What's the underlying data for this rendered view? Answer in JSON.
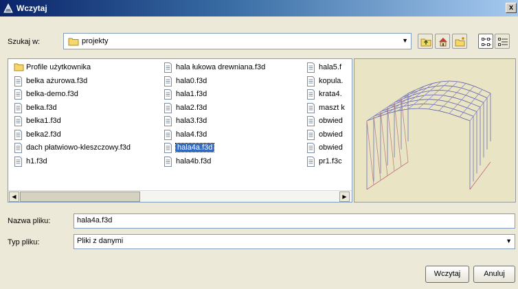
{
  "window": {
    "title": "Wczytaj",
    "close_glyph": "x"
  },
  "lookin": {
    "label": "Szukaj w:",
    "value": "projekty"
  },
  "toolbar": {
    "icons": [
      "up-folder-icon",
      "home-icon",
      "new-folder-icon",
      "list-view-icon",
      "details-view-icon"
    ]
  },
  "files": {
    "columns": [
      [
        "Profile użytkownika",
        "belka ażurowa.f3d",
        "belka-demo.f3d",
        "belka.f3d",
        "belka1.f3d",
        "belka2.f3d",
        "dach płatwiowo-kleszczowy.f3d",
        "h1.f3d"
      ],
      [
        "hala łukowa drewniana.f3d",
        "hala0.f3d",
        "hala1.f3d",
        "hala2.f3d",
        "hala3.f3d",
        "hala4.f3d",
        "hala4a.f3d",
        "hala4b.f3d"
      ],
      [
        "hala5.f",
        "kopula.",
        "krata4.",
        "maszt k",
        "obwied",
        "obwied",
        "obwied",
        "pr1.f3c"
      ]
    ],
    "selected": "hala4a.f3d"
  },
  "filename": {
    "label": "Nazwa pliku:",
    "value": "hala4a.f3d"
  },
  "filetype": {
    "label": "Typ pliku:",
    "value": "Pliki z danymi"
  },
  "buttons": {
    "open": "Wczytaj",
    "cancel": "Anuluj"
  },
  "colors": {
    "selection": "#316ac5",
    "titlebar": "#0a246a",
    "preview_bg": "#e9e4c4"
  }
}
